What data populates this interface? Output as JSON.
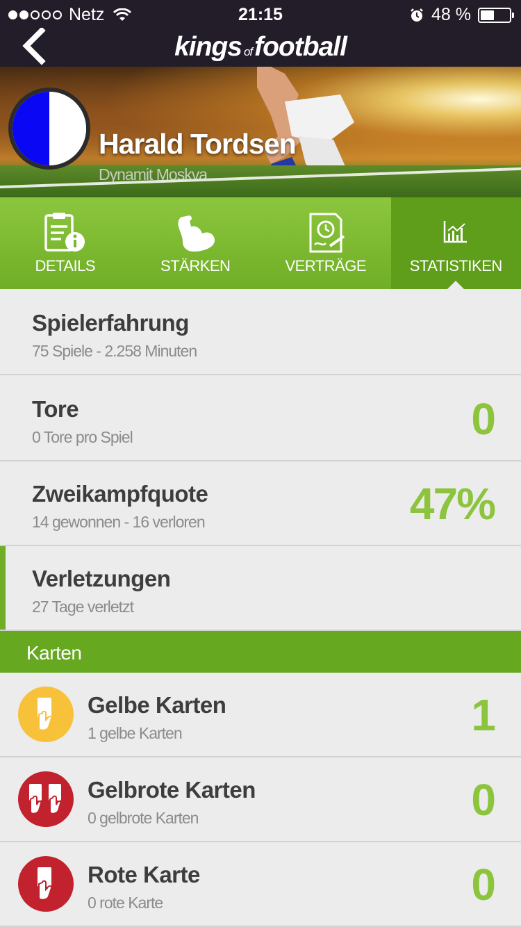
{
  "status_bar": {
    "carrier": "Netz",
    "time": "21:15",
    "battery": "48 %",
    "battery_level": 0.48
  },
  "nav": {
    "brand_part1": "kings",
    "brand_part2": "of",
    "brand_part3": "football"
  },
  "player": {
    "name": "Harald Tordsen",
    "club": "Dynamit Moskva",
    "club_colors": [
      "#0a07f5",
      "#ffffff"
    ]
  },
  "tabs": [
    {
      "label": "DETAILS",
      "icon": "details-info-icon",
      "active": false
    },
    {
      "label": "STÄRKEN",
      "icon": "flexed-arm-icon",
      "active": false
    },
    {
      "label": "VERTRÄGE",
      "icon": "contract-icon",
      "active": false
    },
    {
      "label": "STATISTIKEN",
      "icon": "chart-icon",
      "active": true
    }
  ],
  "stats": {
    "experience": {
      "title": "Spielerfahrung",
      "subtitle": "75 Spiele - 2.258 Minuten"
    },
    "goals": {
      "title": "Tore",
      "subtitle": "0 Tore pro Spiel",
      "value": "0"
    },
    "duels": {
      "title": "Zweikampfquote",
      "subtitle": "14 gewonnen - 16 verloren",
      "value": "47%"
    },
    "injuries": {
      "title": "Verletzungen",
      "subtitle": "27 Tage verletzt"
    }
  },
  "cards_section": {
    "title": "Karten",
    "yellow": {
      "title": "Gelbe Karten",
      "subtitle": "1 gelbe Karten",
      "value": "1",
      "icon": "yellow-card-icon"
    },
    "yellow_red": {
      "title": "Gelbrote Karten",
      "subtitle": "0 gelbrote Karten",
      "value": "0",
      "icon": "yellow-red-card-icon"
    },
    "red": {
      "title": "Rote Karte",
      "subtitle": "0 rote Karte",
      "value": "0",
      "icon": "red-card-icon"
    }
  },
  "colors": {
    "accent_green": "#8dc43d",
    "tab_green": "#6fae26",
    "dark_bar": "#231d29",
    "card_yellow": "#f7c13a",
    "card_red": "#c2212e"
  }
}
